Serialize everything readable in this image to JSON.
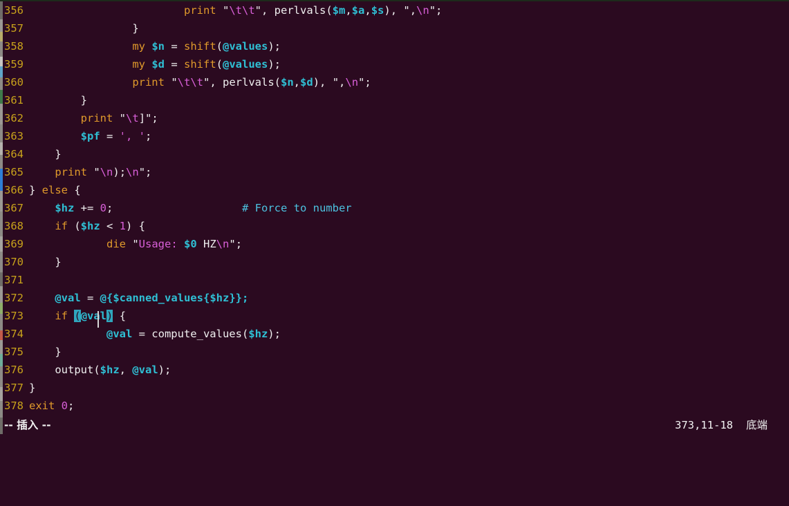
{
  "terminal": {
    "background_color": "#2b0a20",
    "foreground_color": "#f0f0f0",
    "linenumber_color": "#c8a21b",
    "match_paren_color": "#2fa6bd",
    "comment_color": "#4cc2e0",
    "keyword_color": "#e09a2b",
    "variable_color": "#2fbfd4",
    "string_escape_color": "#d85fd8"
  },
  "editor": {
    "first_visible_line": 356,
    "last_visible_line": 378,
    "lines": [
      {
        "n": "356",
        "tokens": [
          {
            "t": "                        ",
            "c": "pl"
          },
          {
            "t": "print",
            "c": "kw"
          },
          {
            "t": " ",
            "c": "pl"
          },
          {
            "t": "\"",
            "c": "str"
          },
          {
            "t": "\\t\\t",
            "c": "esc"
          },
          {
            "t": "\"",
            "c": "str"
          },
          {
            "t": ", perlvals(",
            "c": "pl"
          },
          {
            "t": "$m",
            "c": "var"
          },
          {
            "t": ",",
            "c": "pl"
          },
          {
            "t": "$a",
            "c": "var"
          },
          {
            "t": ",",
            "c": "pl"
          },
          {
            "t": "$s",
            "c": "var"
          },
          {
            "t": "), ",
            "c": "pl"
          },
          {
            "t": "\",",
            "c": "str"
          },
          {
            "t": "\\n",
            "c": "esc"
          },
          {
            "t": "\"",
            "c": "str"
          },
          {
            "t": ";",
            "c": "pl"
          }
        ]
      },
      {
        "n": "357",
        "tokens": [
          {
            "t": "                ",
            "c": "pl"
          },
          {
            "t": "}",
            "c": "pl"
          }
        ]
      },
      {
        "n": "358",
        "tokens": [
          {
            "t": "                ",
            "c": "pl"
          },
          {
            "t": "my",
            "c": "kw"
          },
          {
            "t": " ",
            "c": "pl"
          },
          {
            "t": "$n",
            "c": "var"
          },
          {
            "t": " = ",
            "c": "pl"
          },
          {
            "t": "shift",
            "c": "kw"
          },
          {
            "t": "(",
            "c": "pl"
          },
          {
            "t": "@values",
            "c": "var"
          },
          {
            "t": ");",
            "c": "pl"
          }
        ]
      },
      {
        "n": "359",
        "tokens": [
          {
            "t": "                ",
            "c": "pl"
          },
          {
            "t": "my",
            "c": "kw"
          },
          {
            "t": " ",
            "c": "pl"
          },
          {
            "t": "$d",
            "c": "var"
          },
          {
            "t": " = ",
            "c": "pl"
          },
          {
            "t": "shift",
            "c": "kw"
          },
          {
            "t": "(",
            "c": "pl"
          },
          {
            "t": "@values",
            "c": "var"
          },
          {
            "t": ");",
            "c": "pl"
          }
        ]
      },
      {
        "n": "360",
        "tokens": [
          {
            "t": "                ",
            "c": "pl"
          },
          {
            "t": "print",
            "c": "kw"
          },
          {
            "t": " ",
            "c": "pl"
          },
          {
            "t": "\"",
            "c": "str"
          },
          {
            "t": "\\t\\t",
            "c": "esc"
          },
          {
            "t": "\"",
            "c": "str"
          },
          {
            "t": ", perlvals(",
            "c": "pl"
          },
          {
            "t": "$n",
            "c": "var"
          },
          {
            "t": ",",
            "c": "pl"
          },
          {
            "t": "$d",
            "c": "var"
          },
          {
            "t": "), ",
            "c": "pl"
          },
          {
            "t": "\",",
            "c": "str"
          },
          {
            "t": "\\n",
            "c": "esc"
          },
          {
            "t": "\"",
            "c": "str"
          },
          {
            "t": ";",
            "c": "pl"
          }
        ]
      },
      {
        "n": "361",
        "tokens": [
          {
            "t": "        ",
            "c": "pl"
          },
          {
            "t": "}",
            "c": "pl"
          }
        ]
      },
      {
        "n": "362",
        "tokens": [
          {
            "t": "        ",
            "c": "pl"
          },
          {
            "t": "print",
            "c": "kw"
          },
          {
            "t": " ",
            "c": "pl"
          },
          {
            "t": "\"",
            "c": "str"
          },
          {
            "t": "\\t",
            "c": "esc"
          },
          {
            "t": "]\"",
            "c": "str"
          },
          {
            "t": ";",
            "c": "pl"
          }
        ]
      },
      {
        "n": "363",
        "tokens": [
          {
            "t": "        ",
            "c": "pl"
          },
          {
            "t": "$pf",
            "c": "var"
          },
          {
            "t": " = ",
            "c": "pl"
          },
          {
            "t": "', '",
            "c": "sq"
          },
          {
            "t": ";",
            "c": "pl"
          }
        ]
      },
      {
        "n": "364",
        "tokens": [
          {
            "t": "    ",
            "c": "pl"
          },
          {
            "t": "}",
            "c": "pl"
          }
        ]
      },
      {
        "n": "365",
        "tokens": [
          {
            "t": "    ",
            "c": "pl"
          },
          {
            "t": "print",
            "c": "kw"
          },
          {
            "t": " ",
            "c": "pl"
          },
          {
            "t": "\"",
            "c": "str"
          },
          {
            "t": "\\n",
            "c": "esc"
          },
          {
            "t": ");",
            "c": "str"
          },
          {
            "t": "\\n",
            "c": "esc"
          },
          {
            "t": "\"",
            "c": "str"
          },
          {
            "t": ";",
            "c": "pl"
          }
        ]
      },
      {
        "n": "366",
        "tokens": [
          {
            "t": "} ",
            "c": "pl"
          },
          {
            "t": "else",
            "c": "kw"
          },
          {
            "t": " {",
            "c": "pl"
          }
        ]
      },
      {
        "n": "367",
        "tokens": [
          {
            "t": "    ",
            "c": "pl"
          },
          {
            "t": "$hz",
            "c": "var"
          },
          {
            "t": " += ",
            "c": "pl"
          },
          {
            "t": "0",
            "c": "num"
          },
          {
            "t": ";                    ",
            "c": "pl"
          },
          {
            "t": "# Force to number",
            "c": "cmt"
          }
        ]
      },
      {
        "n": "368",
        "tokens": [
          {
            "t": "    ",
            "c": "pl"
          },
          {
            "t": "if",
            "c": "kw"
          },
          {
            "t": " (",
            "c": "pl"
          },
          {
            "t": "$hz",
            "c": "var"
          },
          {
            "t": " < ",
            "c": "pl"
          },
          {
            "t": "1",
            "c": "num"
          },
          {
            "t": ") {",
            "c": "pl"
          }
        ]
      },
      {
        "n": "369",
        "tokens": [
          {
            "t": "            ",
            "c": "pl"
          },
          {
            "t": "die",
            "c": "kw"
          },
          {
            "t": " ",
            "c": "pl"
          },
          {
            "t": "\"",
            "c": "str"
          },
          {
            "t": "Usage: ",
            "c": "esc"
          },
          {
            "t": "$0",
            "c": "var"
          },
          {
            "t": " HZ",
            "c": "str"
          },
          {
            "t": "\\n",
            "c": "esc"
          },
          {
            "t": "\"",
            "c": "str"
          },
          {
            "t": ";",
            "c": "pl"
          }
        ]
      },
      {
        "n": "370",
        "tokens": [
          {
            "t": "    ",
            "c": "pl"
          },
          {
            "t": "}",
            "c": "pl"
          }
        ]
      },
      {
        "n": "371",
        "tokens": []
      },
      {
        "n": "372",
        "tokens": [
          {
            "t": "    ",
            "c": "pl"
          },
          {
            "t": "@val",
            "c": "var"
          },
          {
            "t": " = ",
            "c": "pl"
          },
          {
            "t": "@{",
            "c": "var"
          },
          {
            "t": "$canned_values",
            "c": "var"
          },
          {
            "t": "{",
            "c": "var"
          },
          {
            "t": "$hz",
            "c": "var"
          },
          {
            "t": "}};",
            "c": "var"
          }
        ]
      },
      {
        "n": "373",
        "tokens": [
          {
            "t": "    ",
            "c": "pl"
          },
          {
            "t": "if",
            "c": "kw"
          },
          {
            "t": " ",
            "c": "pl"
          },
          {
            "t": "(",
            "c": "match"
          },
          {
            "t": "@val",
            "c": "var"
          },
          {
            "t": ")",
            "c": "match"
          },
          {
            "t": " {",
            "c": "pl"
          }
        ]
      },
      {
        "n": "374",
        "tokens": [
          {
            "t": "            ",
            "c": "pl"
          },
          {
            "t": "@val",
            "c": "var"
          },
          {
            "t": " = compute_values(",
            "c": "pl"
          },
          {
            "t": "$hz",
            "c": "var"
          },
          {
            "t": ");",
            "c": "pl"
          }
        ]
      },
      {
        "n": "375",
        "tokens": [
          {
            "t": "    ",
            "c": "pl"
          },
          {
            "t": "}",
            "c": "pl"
          }
        ]
      },
      {
        "n": "376",
        "tokens": [
          {
            "t": "    ",
            "c": "pl"
          },
          {
            "t": "output(",
            "c": "pl"
          },
          {
            "t": "$hz",
            "c": "var"
          },
          {
            "t": ", ",
            "c": "pl"
          },
          {
            "t": "@val",
            "c": "var"
          },
          {
            "t": ");",
            "c": "pl"
          }
        ]
      },
      {
        "n": "377",
        "tokens": [
          {
            "t": "}",
            "c": "pl"
          }
        ]
      },
      {
        "n": "378",
        "tokens": [
          {
            "t": "exit",
            "c": "kw"
          },
          {
            "t": " ",
            "c": "pl"
          },
          {
            "t": "0",
            "c": "num"
          },
          {
            "t": ";",
            "c": "pl"
          }
        ]
      }
    ]
  },
  "statusline": {
    "mode": "-- 插入 --",
    "ruler": "373,11-18",
    "file_position": "底端"
  }
}
